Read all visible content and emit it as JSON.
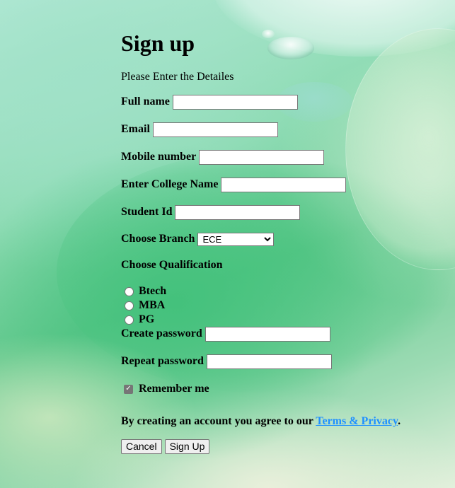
{
  "page": {
    "title": "Sign up",
    "subtitle": "Please Enter the Detailes"
  },
  "form": {
    "full_name": {
      "label": "Full name",
      "value": ""
    },
    "email": {
      "label": "Email",
      "value": ""
    },
    "mobile": {
      "label": "Mobile number",
      "value": ""
    },
    "college": {
      "label": "Enter College Name",
      "value": ""
    },
    "student_id": {
      "label": "Student Id",
      "value": ""
    },
    "branch": {
      "label": "Choose Branch",
      "selected": "ECE"
    },
    "qualification": {
      "label": "Choose Qualification",
      "options": [
        "Btech",
        "MBA",
        "PG"
      ],
      "selected": null
    },
    "password": {
      "label": "Create password",
      "value": ""
    },
    "repeat_password": {
      "label": "Repeat password",
      "value": ""
    },
    "remember": {
      "label": "Remember me",
      "checked": true
    }
  },
  "terms": {
    "text": "By creating an account you agree to our ",
    "link": "Terms & Privacy",
    "end": "."
  },
  "buttons": {
    "cancel": "Cancel",
    "signup": "Sign Up"
  },
  "colors": {
    "link": "#1e90ff",
    "checkbox": "#767676"
  }
}
